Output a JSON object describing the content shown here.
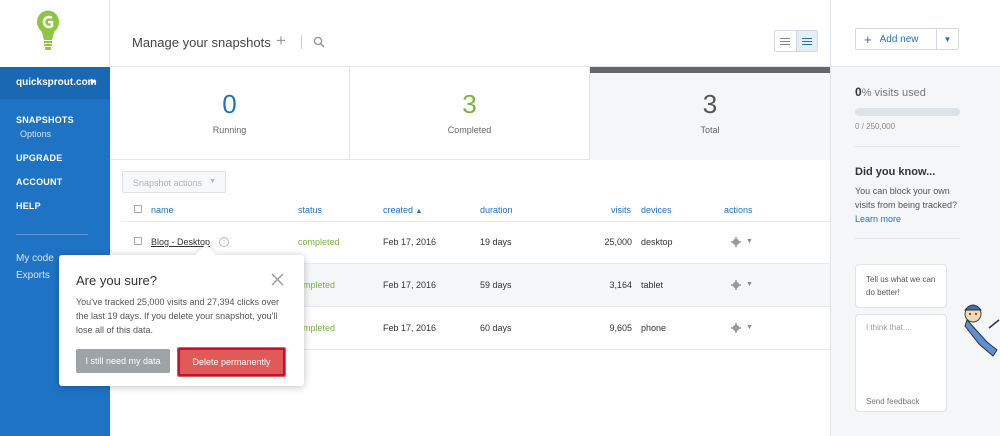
{
  "sidebar": {
    "site": "quicksprout.com",
    "items": [
      {
        "label": "SNAPSHOTS"
      },
      {
        "label": "Options"
      },
      {
        "label": "UPGRADE"
      },
      {
        "label": "ACCOUNT"
      },
      {
        "label": "HELP"
      }
    ],
    "lower_items": [
      {
        "label": "My code"
      },
      {
        "label": "Exports"
      }
    ]
  },
  "header": {
    "title": "Manage your snapshots"
  },
  "right_panel": {
    "add_new_label": "Add new",
    "visits_percent": "0",
    "visits_suffix": "% visits used",
    "visits_count": "0 / 250,000",
    "visits_used_fraction": 0,
    "did_you_know_title": "Did you know...",
    "did_you_know_text": "You can block your own visits from being tracked?",
    "learn_more": "Learn more",
    "feedback_prompt": "Tell us what we can do better!",
    "feedback_placeholder": "I think that...",
    "send_feedback": "Send feedback"
  },
  "stats": {
    "running": {
      "value": "0",
      "label": "Running",
      "color": "#1f73c4"
    },
    "completed": {
      "value": "3",
      "label": "Completed",
      "color": "#7cb33e"
    },
    "total": {
      "value": "3",
      "label": "Total",
      "color": "#555555"
    }
  },
  "table": {
    "actions_label": "Snapshot actions",
    "headers": {
      "name": "name",
      "status": "status",
      "created": "created",
      "duration": "duration",
      "visits": "visits",
      "devices": "devices",
      "actions": "actions"
    },
    "rows": [
      {
        "name": "Blog - Desktop",
        "status": "completed",
        "created": "Feb 17, 2016",
        "duration": "19 days",
        "visits": "25,000",
        "devices": "desktop"
      },
      {
        "name": "",
        "status": "ompleted",
        "created": "Feb 17, 2016",
        "duration": "59 days",
        "visits": "3,164",
        "devices": "tablet"
      },
      {
        "name": "",
        "status": "ompleted",
        "created": "Feb 17, 2016",
        "duration": "60 days",
        "visits": "9,605",
        "devices": "phone"
      }
    ]
  },
  "modal": {
    "title": "Are you sure?",
    "body": "You've tracked 25,000 visits and 27,394 clicks over the last 19 days. If you delete your snapshot, you'll lose all of this data.",
    "keep_label": "I still need my data",
    "delete_label": "Delete permanently"
  },
  "colors": {
    "brand_blue": "#1f73c4",
    "status_green": "#7cb33e",
    "danger_red": "#e05a5a",
    "logo_green": "#8dc63f"
  },
  "icons": [
    "logo-bulb-icon",
    "chevron-right-icon",
    "plus-icon",
    "search-icon",
    "list-view-icon",
    "compact-view-icon",
    "chevron-down-icon",
    "sort-up-icon",
    "info-icon",
    "gear-icon",
    "close-icon",
    "mascot-icon"
  ]
}
